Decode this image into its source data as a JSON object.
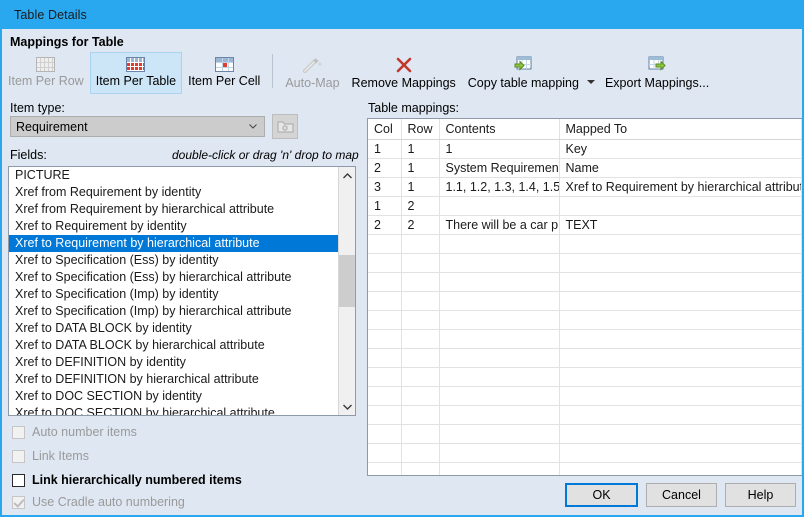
{
  "window": {
    "title": "Table Details",
    "header": "Mappings for Table",
    "title_bar_color": "#29a8f0",
    "body_color": "#dfe7f2",
    "selection_color": "#0078d7"
  },
  "toolbar": {
    "buttons": [
      {
        "label": "Item Per Row",
        "icon": "grid-row-icon",
        "state": "disabled"
      },
      {
        "label": "Item Per Table",
        "icon": "grid-table-icon",
        "state": "selected"
      },
      {
        "label": "Item Per Cell",
        "icon": "grid-cell-icon",
        "state": "normal"
      },
      {
        "label": "Auto-Map",
        "icon": "magic-wand-icon",
        "state": "disabled"
      },
      {
        "label": "Remove Mappings",
        "icon": "red-x-icon",
        "state": "normal"
      },
      {
        "label": "Copy table mapping",
        "icon": "copy-table-icon",
        "state": "normal"
      },
      {
        "label": "Export Mappings...",
        "icon": "export-table-icon",
        "state": "normal"
      }
    ]
  },
  "left_panel": {
    "item_type_label": "Item type:",
    "item_type_value": "Requirement",
    "browse_icon": "folder-icon",
    "fields_label": "Fields:",
    "fields_hint": "double-click or drag 'n' drop to map",
    "fields": [
      {
        "label": "PICTURE",
        "selected": false
      },
      {
        "label": "Xref from Requirement by identity",
        "selected": false
      },
      {
        "label": "Xref from Requirement by hierarchical attribute",
        "selected": false
      },
      {
        "label": "Xref to Requirement by identity",
        "selected": false
      },
      {
        "label": "Xref to Requirement by hierarchical attribute",
        "selected": true
      },
      {
        "label": "Xref to Specification (Ess) by identity",
        "selected": false
      },
      {
        "label": "Xref to Specification (Ess) by hierarchical attribute",
        "selected": false
      },
      {
        "label": "Xref to Specification (Imp) by identity",
        "selected": false
      },
      {
        "label": "Xref to Specification (Imp) by hierarchical attribute",
        "selected": false
      },
      {
        "label": "Xref to DATA BLOCK by identity",
        "selected": false
      },
      {
        "label": "Xref to DATA BLOCK by hierarchical attribute",
        "selected": false
      },
      {
        "label": "Xref to DEFINITION by identity",
        "selected": false
      },
      {
        "label": "Xref to DEFINITION by hierarchical attribute",
        "selected": false
      },
      {
        "label": "Xref to DOC SECTION by identity",
        "selected": false
      },
      {
        "label": "Xref to DOC SECTION by hierarchical attribute",
        "selected": false
      }
    ],
    "checkboxes": [
      {
        "label": "Auto number items",
        "checked": false,
        "enabled": false,
        "bold": false
      },
      {
        "label": "Link Items",
        "checked": false,
        "enabled": false,
        "bold": false
      },
      {
        "label": "Link hierarchically numbered items",
        "checked": false,
        "enabled": true,
        "bold": true
      },
      {
        "label": "Use Cradle auto numbering",
        "checked": true,
        "enabled": false,
        "bold": false
      }
    ]
  },
  "right_panel": {
    "table_label": "Table mappings:",
    "columns": [
      "Col",
      "Row",
      "Contents",
      "Mapped To"
    ],
    "rows": [
      {
        "col": "1",
        "row": "1",
        "contents": "1",
        "mapped_to": "Key"
      },
      {
        "col": "2",
        "row": "1",
        "contents": "System Requirements",
        "mapped_to": "Name"
      },
      {
        "col": "3",
        "row": "1",
        "contents": "1.1, 1.2, 1.3, 1.4, 1.5",
        "mapped_to": "Xref to Requirement by hierarchical attribute"
      },
      {
        "col": "1",
        "row": "2",
        "contents": "",
        "mapped_to": ""
      },
      {
        "col": "2",
        "row": "2",
        "contents": "There will be a car p...",
        "mapped_to": "TEXT"
      },
      {
        "col": "",
        "row": "",
        "contents": "",
        "mapped_to": ""
      },
      {
        "col": "",
        "row": "",
        "contents": "",
        "mapped_to": ""
      },
      {
        "col": "",
        "row": "",
        "contents": "",
        "mapped_to": ""
      },
      {
        "col": "",
        "row": "",
        "contents": "",
        "mapped_to": ""
      },
      {
        "col": "",
        "row": "",
        "contents": "",
        "mapped_to": ""
      },
      {
        "col": "",
        "row": "",
        "contents": "",
        "mapped_to": ""
      },
      {
        "col": "",
        "row": "",
        "contents": "",
        "mapped_to": ""
      },
      {
        "col": "",
        "row": "",
        "contents": "",
        "mapped_to": ""
      },
      {
        "col": "",
        "row": "",
        "contents": "",
        "mapped_to": ""
      },
      {
        "col": "",
        "row": "",
        "contents": "",
        "mapped_to": ""
      },
      {
        "col": "",
        "row": "",
        "contents": "",
        "mapped_to": ""
      },
      {
        "col": "",
        "row": "",
        "contents": "",
        "mapped_to": ""
      },
      {
        "col": "",
        "row": "",
        "contents": "",
        "mapped_to": ""
      }
    ]
  },
  "footer": {
    "ok": "OK",
    "cancel": "Cancel",
    "help": "Help"
  }
}
